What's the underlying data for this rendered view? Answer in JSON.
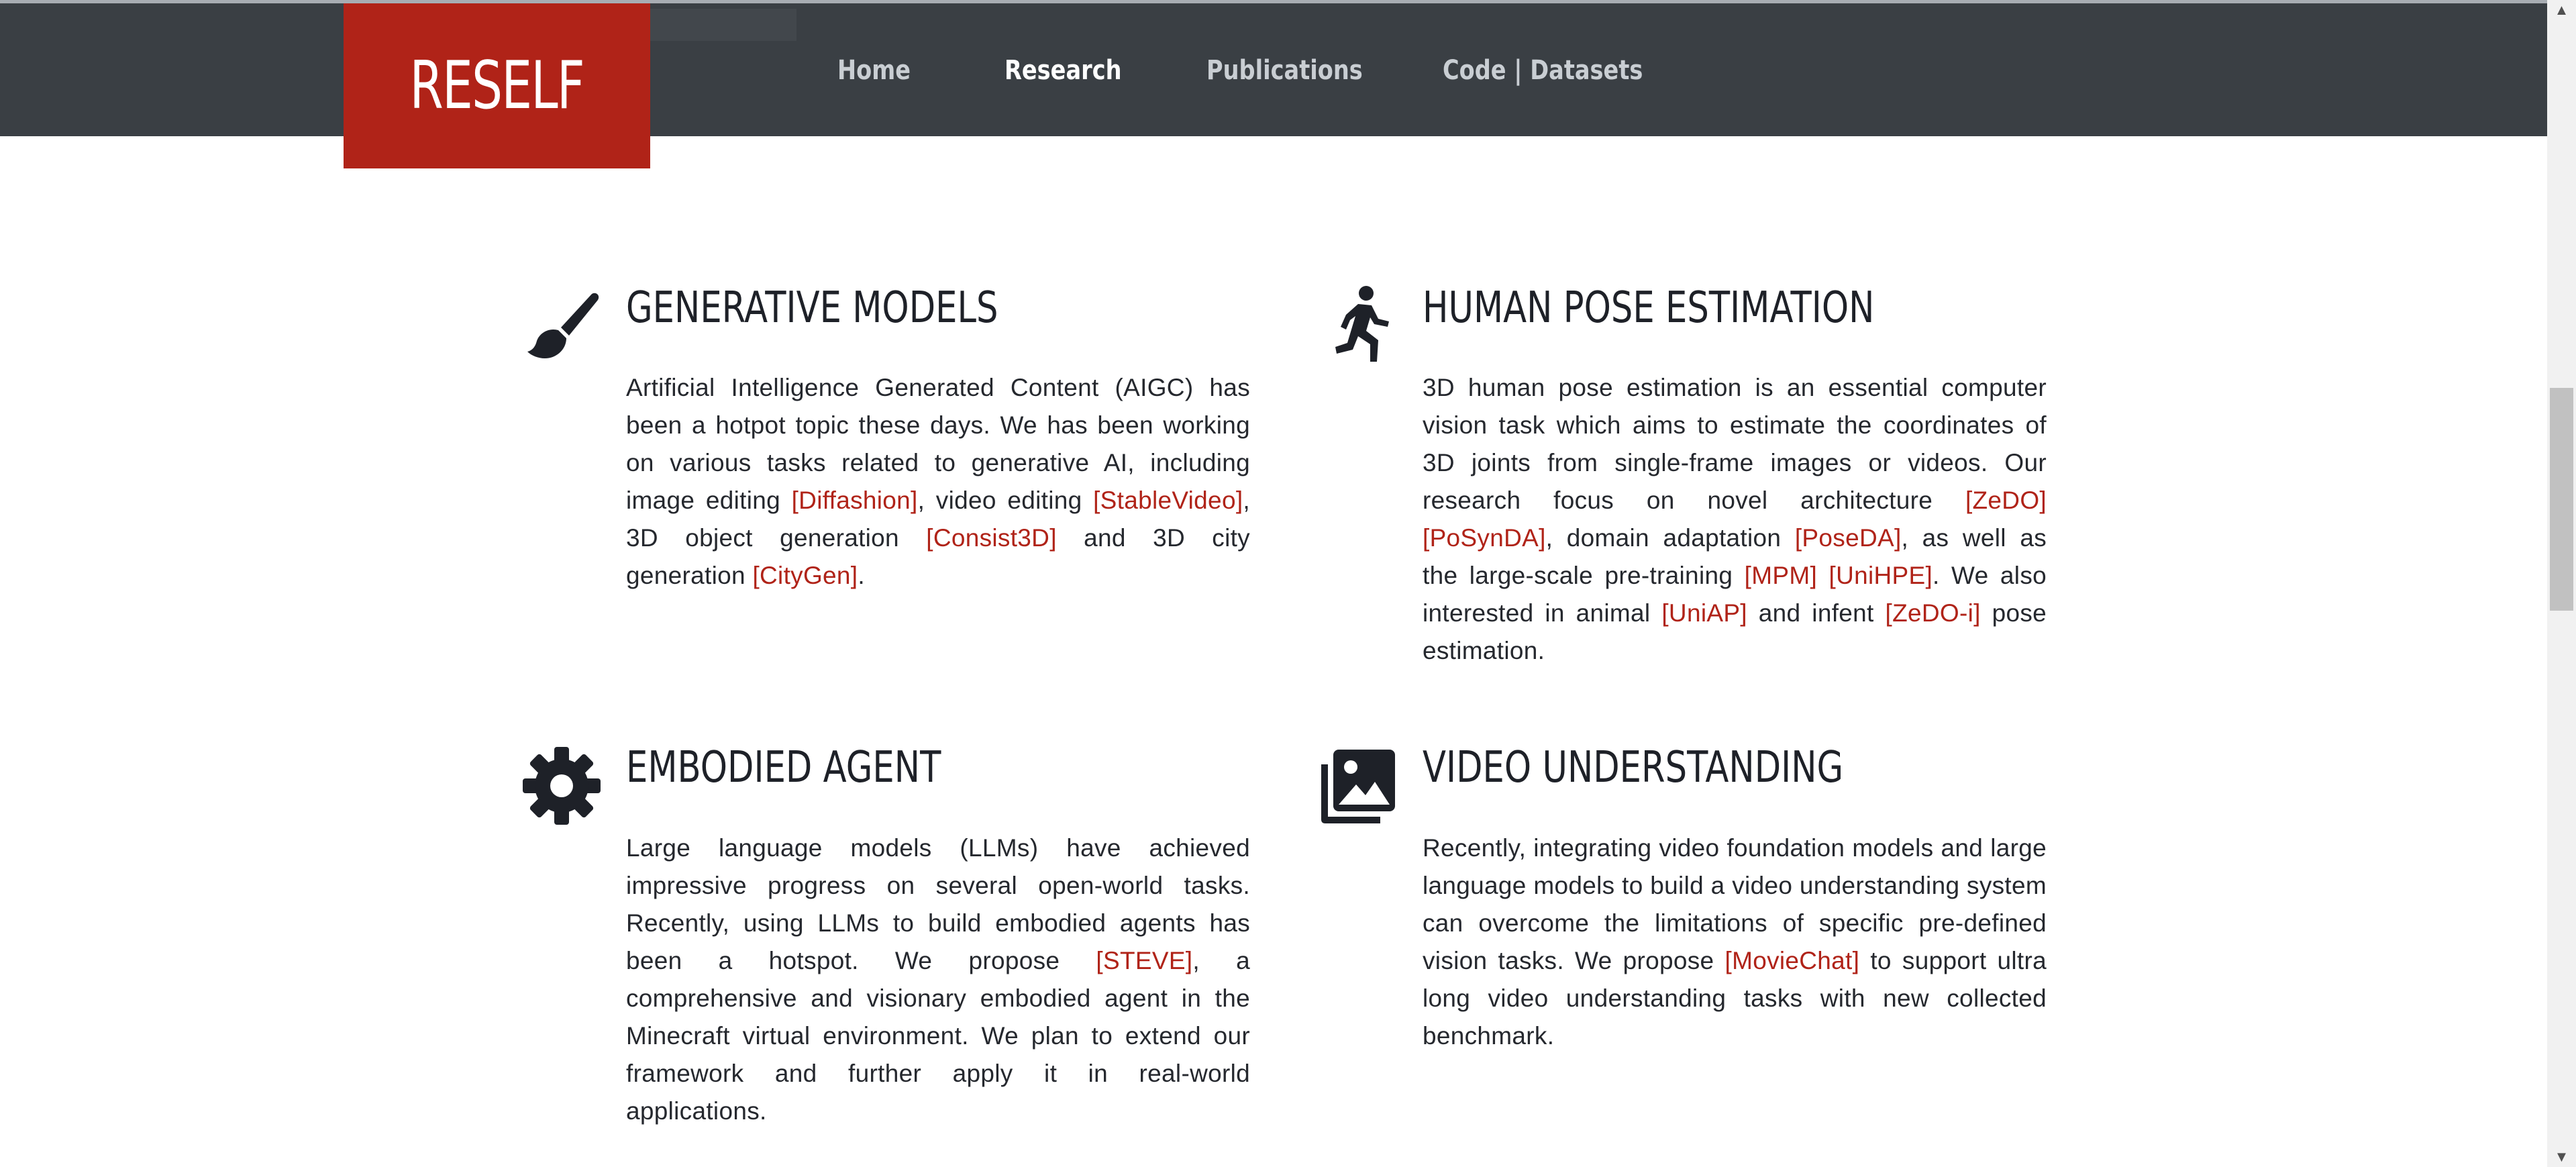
{
  "brand": {
    "logo_text": "RESELF"
  },
  "nav": {
    "items": [
      {
        "label": "Home",
        "active": false
      },
      {
        "label": "Research",
        "active": true
      },
      {
        "label": "Publications",
        "active": false
      },
      {
        "label": "Code | Datasets",
        "active": false
      }
    ]
  },
  "colors": {
    "navbar_bg": "#3a3f44",
    "brand_red": "#b02318",
    "link_red": "#b02318",
    "text_dark": "#1e2128"
  },
  "sections": [
    {
      "icon": "paintbrush-icon",
      "title": "GENERATIVE MODELS",
      "segments": [
        {
          "t": "Artificial Intelligence Generated Content (AIGC) has been a hotpot topic these days. We has been working on various tasks related to generative AI, including image editing "
        },
        {
          "link": "[Diffashion]"
        },
        {
          "t": ", video editing "
        },
        {
          "link": "[StableVideo]"
        },
        {
          "t": ", 3D object generation "
        },
        {
          "link": "[Consist3D]"
        },
        {
          "t": " and 3D city generation "
        },
        {
          "link": "[CityGen]"
        },
        {
          "t": "."
        }
      ]
    },
    {
      "icon": "running-person-icon",
      "title": "HUMAN POSE ESTIMATION",
      "segments": [
        {
          "t": "3D human pose estimation is an essential computer vision task which aims to estimate the coordinates of 3D joints from single-frame images or videos. Our research focus on novel architecture "
        },
        {
          "link": "[ZeDO]"
        },
        {
          "t": " "
        },
        {
          "link": "[PoSynDA]"
        },
        {
          "t": ", domain adaptation "
        },
        {
          "link": "[PoseDA]"
        },
        {
          "t": ", as well as the large-scale pre-training "
        },
        {
          "link": "[MPM]"
        },
        {
          "t": " "
        },
        {
          "link": "[UniHPE]"
        },
        {
          "t": ". We also interested in animal "
        },
        {
          "link": "[UniAP]"
        },
        {
          "t": " and infent "
        },
        {
          "link": "[ZeDO-i]"
        },
        {
          "t": " pose estimation."
        }
      ]
    },
    {
      "icon": "gear-icon",
      "title": "EMBODIED AGENT",
      "segments": [
        {
          "t": "Large language models (LLMs) have achieved impressive progress on several open-world tasks. Recently, using LLMs to build embodied agents has been a hotspot. We propose "
        },
        {
          "link": "[STEVE]"
        },
        {
          "t": ", a comprehensive and visionary embodied agent in the Minecraft virtual environment. We plan to extend our framework and further apply it in real-world applications."
        }
      ]
    },
    {
      "icon": "photo-gallery-icon",
      "title": "VIDEO UNDERSTANDING",
      "segments": [
        {
          "t": "Recently, integrating video foundation models and large language models to build a video understanding system can overcome the limitations of specific pre-defined vision tasks. We propose "
        },
        {
          "link": "[MovieChat]"
        },
        {
          "t": " to support ultra long video understanding tasks with new collected benchmark."
        }
      ]
    }
  ]
}
